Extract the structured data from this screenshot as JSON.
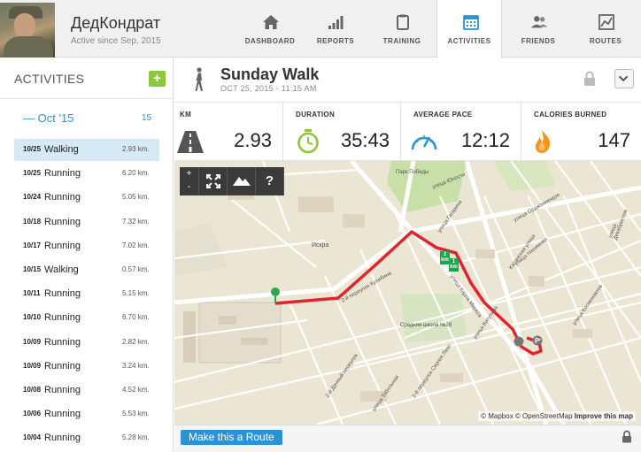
{
  "user": {
    "name": "ДедКондрат",
    "since": "Active since Sep, 2015"
  },
  "nav": [
    {
      "label": "DASHBOARD",
      "icon": "home-icon"
    },
    {
      "label": "REPORTS",
      "icon": "bar-chart-icon"
    },
    {
      "label": "TRAINING",
      "icon": "clipboard-icon"
    },
    {
      "label": "ACTIVITIES",
      "icon": "calendar-icon",
      "active": true
    },
    {
      "label": "FRIENDS",
      "icon": "friends-icon"
    },
    {
      "label": "ROUTES",
      "icon": "route-map-icon"
    }
  ],
  "sidebar": {
    "title": "ACTIVITIES",
    "add_label": "+",
    "month": {
      "label": "Oct '15",
      "count": "15"
    },
    "activities": [
      {
        "date": "10/25",
        "type": "Walking",
        "dist": "2.93 km."
      },
      {
        "date": "10/25",
        "type": "Running",
        "dist": "6.20 km."
      },
      {
        "date": "10/24",
        "type": "Running",
        "dist": "5.05 km."
      },
      {
        "date": "10/18",
        "type": "Running",
        "dist": "7.32 km."
      },
      {
        "date": "10/17",
        "type": "Running",
        "dist": "7.02 km."
      },
      {
        "date": "10/15",
        "type": "Walking",
        "dist": "0.57 km."
      },
      {
        "date": "10/11",
        "type": "Running",
        "dist": "5.15 km."
      },
      {
        "date": "10/10",
        "type": "Running",
        "dist": "6.70 km."
      },
      {
        "date": "10/09",
        "type": "Running",
        "dist": "2.82 km."
      },
      {
        "date": "10/09",
        "type": "Running",
        "dist": "3.24 km."
      },
      {
        "date": "10/08",
        "type": "Running",
        "dist": "4.52 km."
      },
      {
        "date": "10/06",
        "type": "Running",
        "dist": "5.53 km."
      },
      {
        "date": "10/04",
        "type": "Running",
        "dist": "5.28 km."
      }
    ]
  },
  "activity": {
    "title": "Sunday Walk",
    "datetime": "OCT 25, 2015  -  11:15 AM",
    "stats": [
      {
        "label": "KM",
        "value": "2.93",
        "icon": "road-icon"
      },
      {
        "label": "DURATION",
        "value": "35:43",
        "icon": "stopwatch-icon"
      },
      {
        "label": "AVERAGE PACE",
        "value": "12:12",
        "icon": "speedometer-icon"
      },
      {
        "label": "CALORIES BURNED",
        "value": "147",
        "icon": "flame-icon"
      }
    ]
  },
  "map": {
    "zoom_in": "+",
    "zoom_out": "-",
    "help": "?",
    "place_labels": [
      "Парк Победы",
      "улица Юности",
      "Искра",
      "улица Орджоникидзе",
      "Казанская улица",
      "улица Гагарина",
      "улица Нахимова",
      "улица Ватутина",
      "Средняя школа №28",
      "2-й переулок Кулибина",
      "улица Карла Маркса",
      "улица Космонавтов",
      "улица Декабристов",
      "2-й Дачный переулок",
      "2-й переулок Сергея Лазо",
      "улица Тобольная"
    ],
    "km_markers": [
      "1 km",
      "2 km"
    ],
    "attribution": {
      "mapbox": "© Mapbox",
      "osm": "© OpenStreetMap",
      "improve": "Improve this map"
    }
  },
  "bottom": {
    "route_button": "Make this a Route"
  },
  "colors": {
    "accent": "#2a93d5",
    "add": "#8dc63f",
    "route": "#e0242f",
    "start": "#2ea64a",
    "km": "#17a84b"
  }
}
